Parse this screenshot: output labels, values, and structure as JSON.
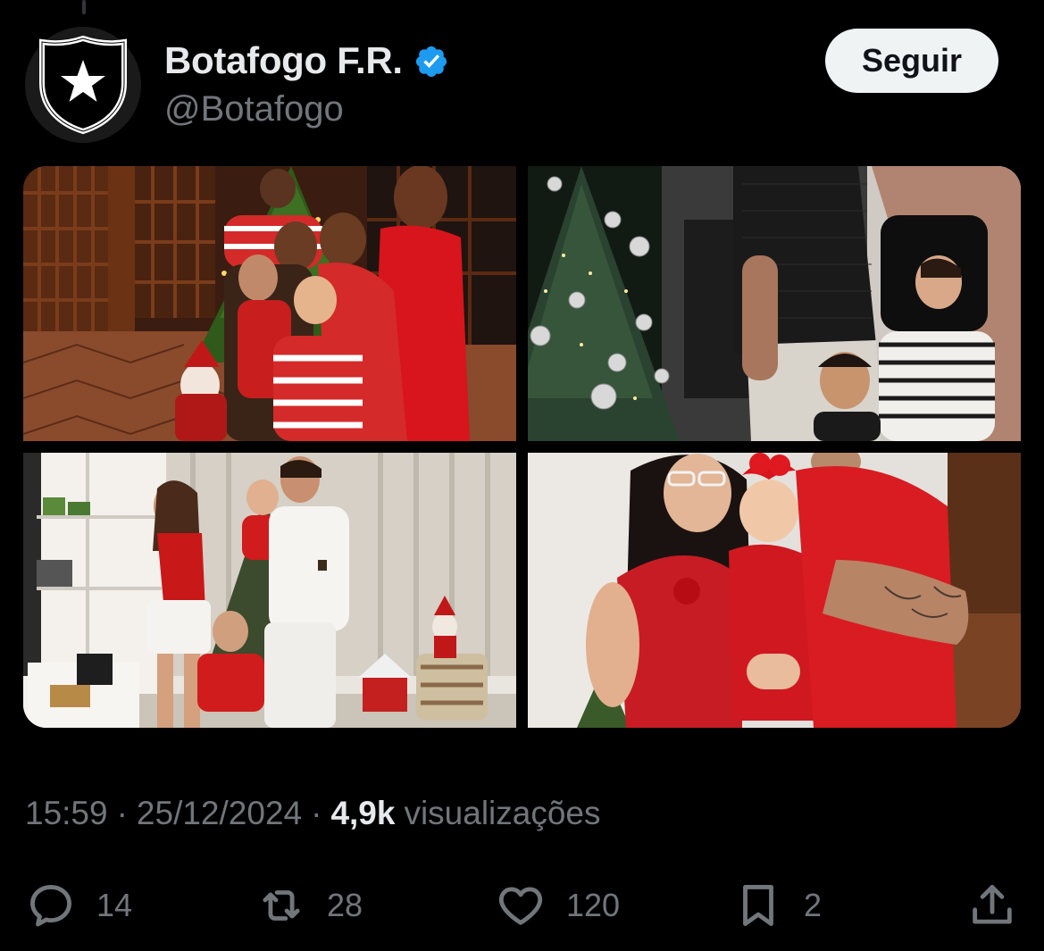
{
  "tweet": {
    "display_name": "Botafogo F.R.",
    "handle": "@Botafogo",
    "follow_label": "Seguir",
    "time": "15:59",
    "date": "25/12/2024",
    "separator": "·",
    "views_count": "4,9k",
    "views_label": "visualizações",
    "media": [
      {
        "name": "family-photo-1"
      },
      {
        "name": "family-photo-2"
      },
      {
        "name": "family-photo-3"
      },
      {
        "name": "family-photo-4"
      }
    ]
  },
  "actions": {
    "replies": "14",
    "retweets": "28",
    "likes": "120",
    "bookmarks": "2"
  },
  "icons": {
    "avatar": "botafogo-star-shield-icon",
    "verified": "verified-badge-icon",
    "reply": "reply-icon",
    "retweet": "retweet-icon",
    "like": "heart-icon",
    "bookmark": "bookmark-icon",
    "share": "share-icon"
  },
  "colors": {
    "background": "#000000",
    "text_primary": "#e7e9ea",
    "text_secondary": "#71767b",
    "verified_blue": "#1d9bf0",
    "follow_bg": "#eff3f4"
  }
}
